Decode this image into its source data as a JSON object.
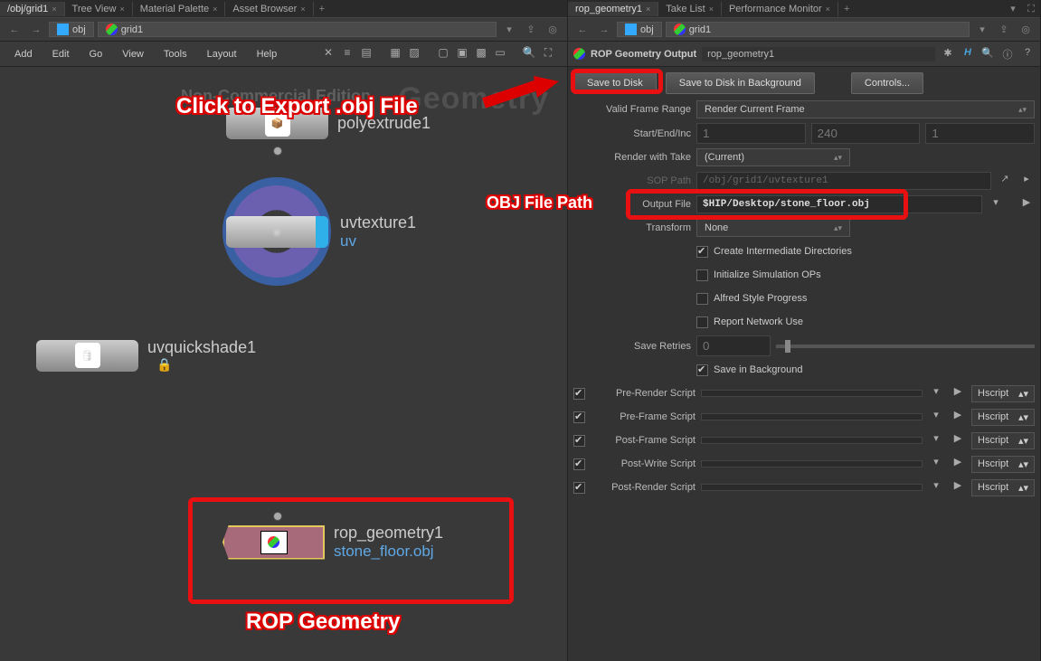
{
  "left": {
    "tabs": [
      "/obj/grid1",
      "Tree View",
      "Material Palette",
      "Asset Browser"
    ],
    "path": {
      "seg1": "obj",
      "seg2": "grid1"
    },
    "menu": [
      "Add",
      "Edit",
      "Go",
      "View",
      "Tools",
      "Layout",
      "Help"
    ],
    "watermark1": "Non-Commercial Edition",
    "watermark2": "Geometry",
    "nodes": {
      "polyextrude": {
        "label": "polyextrude1"
      },
      "uvtexture": {
        "label": "uvtexture1",
        "sub": "uv"
      },
      "uvquickshade": {
        "label": "uvquickshade1"
      },
      "rop": {
        "label": "rop_geometry1",
        "sub": "stone_floor.obj"
      }
    },
    "anno_export": "Click to Export .obj File",
    "anno_rop": "ROP Geometry"
  },
  "right": {
    "tabs": [
      "rop_geometry1",
      "Take List",
      "Performance Monitor"
    ],
    "path": {
      "seg1": "obj",
      "seg2": "grid1"
    },
    "title": "ROP Geometry Output",
    "name": "rop_geometry1",
    "buttons": {
      "save": "Save to Disk",
      "savebg": "Save to Disk in Background",
      "controls": "Controls..."
    },
    "params": {
      "validFrame": {
        "label": "Valid Frame Range",
        "value": "Render Current Frame"
      },
      "startEnd": {
        "label": "Start/End/Inc",
        "a": "1",
        "b": "240",
        "c": "1"
      },
      "renderTake": {
        "label": "Render with Take",
        "value": "(Current)"
      },
      "sopPath": {
        "label": "SOP Path",
        "value": "/obj/grid1/uvtexture1"
      },
      "outputFile": {
        "label": "Output File",
        "value": "$HIP/Desktop/stone_floor.obj"
      },
      "transform": {
        "label": "Transform",
        "value": "None"
      },
      "cb1": "Create Intermediate Directories",
      "cb2": "Initialize Simulation OPs",
      "cb3": "Alfred Style Progress",
      "cb4": "Report Network Use",
      "saveRetries": {
        "label": "Save Retries",
        "value": "0"
      },
      "cb5": "Save in Background",
      "scripts": {
        "pre_render": "Pre-Render Script",
        "pre_frame": "Pre-Frame Script",
        "post_frame": "Post-Frame Script",
        "post_write": "Post-Write Script",
        "post_render": "Post-Render Script",
        "lang": "Hscript"
      }
    },
    "anno_path": "OBJ File Path"
  }
}
